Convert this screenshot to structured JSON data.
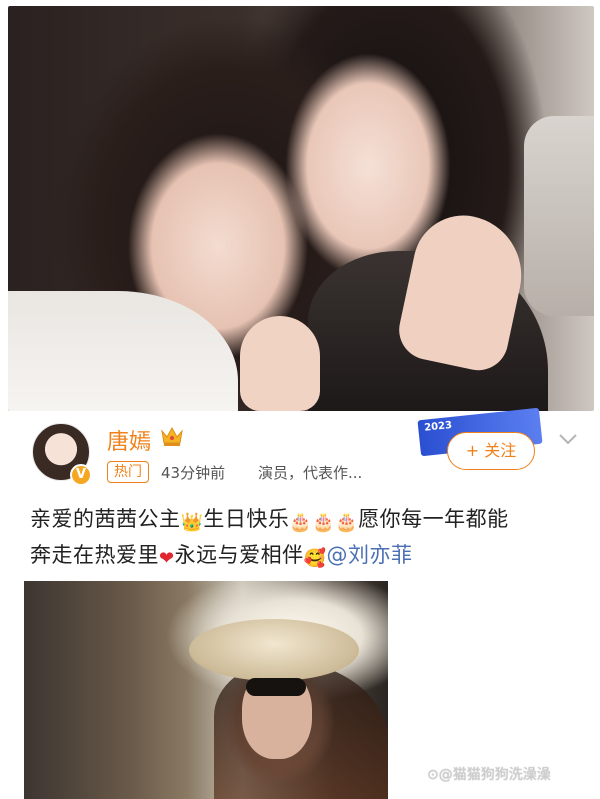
{
  "post": {
    "username": "唐嫣",
    "tag": "热门",
    "time": "43分钟前",
    "description": "演员，代表作...",
    "follow_label": "+ 关注",
    "avatar_badge": "V",
    "banner_text": "2023",
    "text_line1_a": "亲爱的茜茜公主",
    "text_line1_b": "生日快乐",
    "text_line1_c": "愿你每一年都能",
    "text_line2_a": "奔走在热爱里",
    "text_line2_b": "永远与爱相伴",
    "mention": "@刘亦菲"
  },
  "icons": {
    "crown": "crown-icon",
    "cake": "🎂",
    "heart": "❤",
    "hug": "🥰",
    "crown_glyph": "👑"
  },
  "watermark": "⊙@猫猫狗狗洗澡澡",
  "colors": {
    "accent": "#f0811a",
    "mention": "#4a6fb5"
  }
}
